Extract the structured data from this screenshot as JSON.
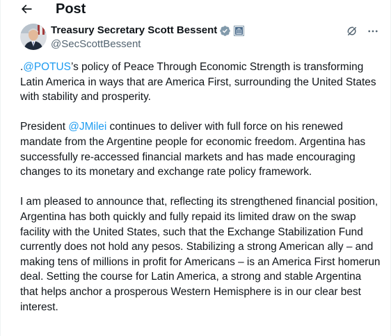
{
  "topbar": {
    "title": "Post"
  },
  "author": {
    "display_name": "Treasury Secretary Scott Bessent",
    "handle": "@SecScottBessent"
  },
  "tweet": {
    "paragraphs": [
      {
        "prefix": ".",
        "mention": "@POTUS",
        "suffix": "’s policy of Peace Through Economic Strength is transforming Latin America in ways that are America First, surrounding the United States with stability and prosperity."
      },
      {
        "prefix": "President ",
        "mention": "@JMilei",
        "suffix": " continues to deliver with full force on his renewed mandate from the Argentine people for economic freedom.  Argentina has successfully re-accessed financial markets and has made encouraging changes to its monetary and exchange rate policy framework."
      },
      {
        "text": "I am pleased to announce that, reflecting its strengthened financial position, Argentina has both quickly and fully repaid its limited draw on the swap facility with the United States, such that the Exchange Stabilization Fund currently does not hold any pesos.  Stabilizing a strong American ally – and making tens of millions in profit for Americans – is an America First homerun deal.  Setting the course for Latin America, a strong and stable Argentina that helps anchor a prosperous Western Hemisphere is in our clear best interest."
      }
    ]
  },
  "icons": {
    "back": "arrow-left-icon",
    "verified": "verified-badge-icon",
    "gov": "government-affiliation-icon",
    "grok": "grok-icon",
    "more": "more-options-icon"
  },
  "colors": {
    "text": "#0f1419",
    "secondary": "#536471",
    "link": "#1d9bf0",
    "verified_badge": "#829aab"
  }
}
